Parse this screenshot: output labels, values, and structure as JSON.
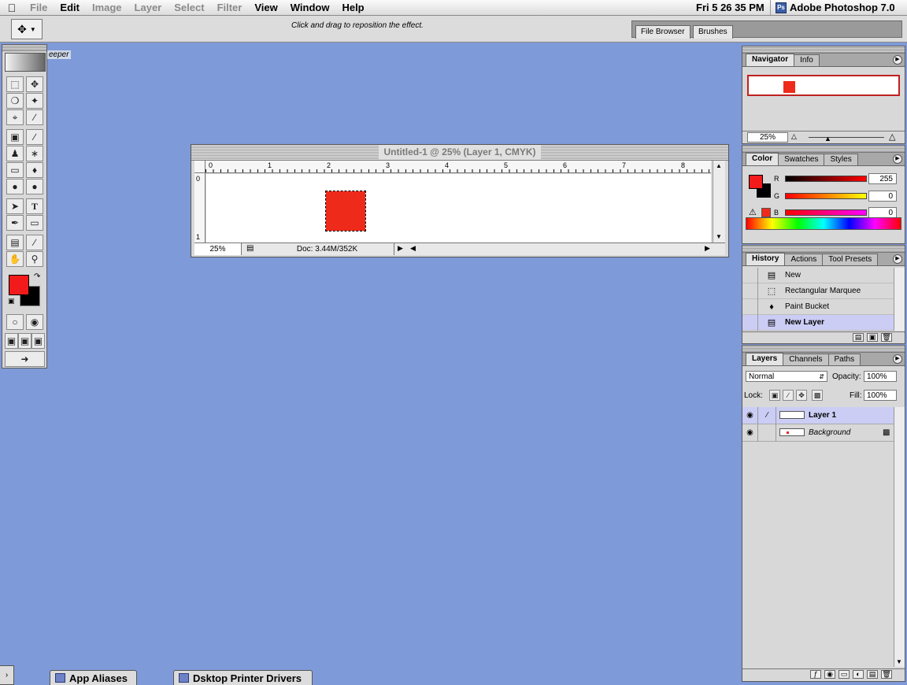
{
  "menubar": {
    "items": [
      "File",
      "Edit",
      "Image",
      "Layer",
      "Select",
      "Filter",
      "View",
      "Window",
      "Help"
    ],
    "clock": "Fri 5 26 35 PM",
    "app_name": "Adobe Photoshop 7.0"
  },
  "options": {
    "hint": "Click and drag to reposition the effect.",
    "well_tabs": [
      "File Browser",
      "Brushes"
    ]
  },
  "toolbox": {
    "ghost_label": "eeper"
  },
  "document": {
    "title": "Untitled-1 @ 25% (Layer 1, CMYK)",
    "ruler_h": [
      "0",
      "1",
      "2",
      "3",
      "4",
      "5",
      "6",
      "7",
      "8"
    ],
    "ruler_v": [
      "0",
      "1"
    ],
    "zoom": "25%",
    "doc_size": "Doc: 3.44M/352K"
  },
  "navigator": {
    "tabs": [
      "Navigator",
      "Info"
    ],
    "zoom": "25%"
  },
  "color": {
    "tabs": [
      "Color",
      "Swatches",
      "Styles"
    ],
    "r_label": "R",
    "g_label": "G",
    "b_label": "B",
    "r": "255",
    "g": "0",
    "b": "0",
    "fg_hex": "#f21a1a"
  },
  "history": {
    "tabs": [
      "History",
      "Actions",
      "Tool Presets"
    ],
    "items": [
      "New",
      "Rectangular Marquee",
      "Paint Bucket",
      "New Layer"
    ]
  },
  "layers": {
    "tabs": [
      "Layers",
      "Channels",
      "Paths"
    ],
    "blend_mode": "Normal",
    "opacity_label": "Opacity:",
    "opacity": "100%",
    "lock_label": "Lock:",
    "fill_label": "Fill:",
    "fill": "100%",
    "rows": [
      "Layer 1",
      "Background"
    ]
  },
  "dock": [
    "App Aliases",
    "Dsktop Printer Drivers"
  ]
}
